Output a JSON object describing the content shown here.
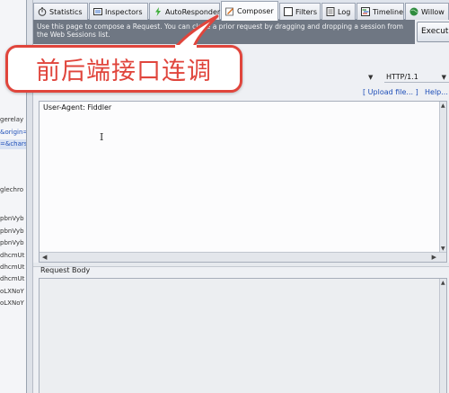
{
  "tabs": [
    {
      "label": "Statistics",
      "icon": "stopwatch-icon",
      "active": false
    },
    {
      "label": "Inspectors",
      "icon": "inspectors-icon",
      "active": false
    },
    {
      "label": "AutoResponder",
      "icon": "lightning-icon",
      "active": false
    },
    {
      "label": "Composer",
      "icon": "pencil-icon",
      "active": true
    },
    {
      "label": "Filters",
      "icon": "checkbox-icon",
      "active": false
    },
    {
      "label": "Log",
      "icon": "log-icon",
      "active": false
    },
    {
      "label": "Timeline",
      "icon": "timeline-icon",
      "active": false
    },
    {
      "label": "Willow",
      "icon": "globe-icon",
      "active": false
    }
  ],
  "composer": {
    "info_text": "Use this page to compose a Request. You can clone a prior request by dragging and dropping a session from the Web Sessions list.",
    "execute_label": "Executе",
    "http_version": "HTTP/1.1",
    "upload_label": "[ Upload file... ]",
    "help_label": "Help...",
    "headers_text": "User-Agent: Fiddler",
    "request_body_label": "Request Body"
  },
  "sessions": [
    {
      "text": "gerelay",
      "color": "normal"
    },
    {
      "text": "&origin=",
      "color": "blue"
    },
    {
      "text": "=&chars",
      "color": "blue"
    },
    {
      "text": "glechro",
      "color": "normal"
    },
    {
      "text": "pbnVyb",
      "color": "normal"
    },
    {
      "text": "pbnVyb",
      "color": "normal"
    },
    {
      "text": "pbnVyb",
      "color": "normal"
    },
    {
      "text": "dhcmUt",
      "color": "normal"
    },
    {
      "text": "dhcmUt",
      "color": "normal"
    },
    {
      "text": "dhcmUt",
      "color": "normal"
    },
    {
      "text": "oLXNoY",
      "color": "normal"
    },
    {
      "text": "oLXNoY",
      "color": "normal"
    }
  ],
  "callout": {
    "text": "前后端接口连调",
    "color": "#e0453c"
  },
  "colors": {
    "info_bar": "#6f7783",
    "link": "#1f4fb8"
  }
}
